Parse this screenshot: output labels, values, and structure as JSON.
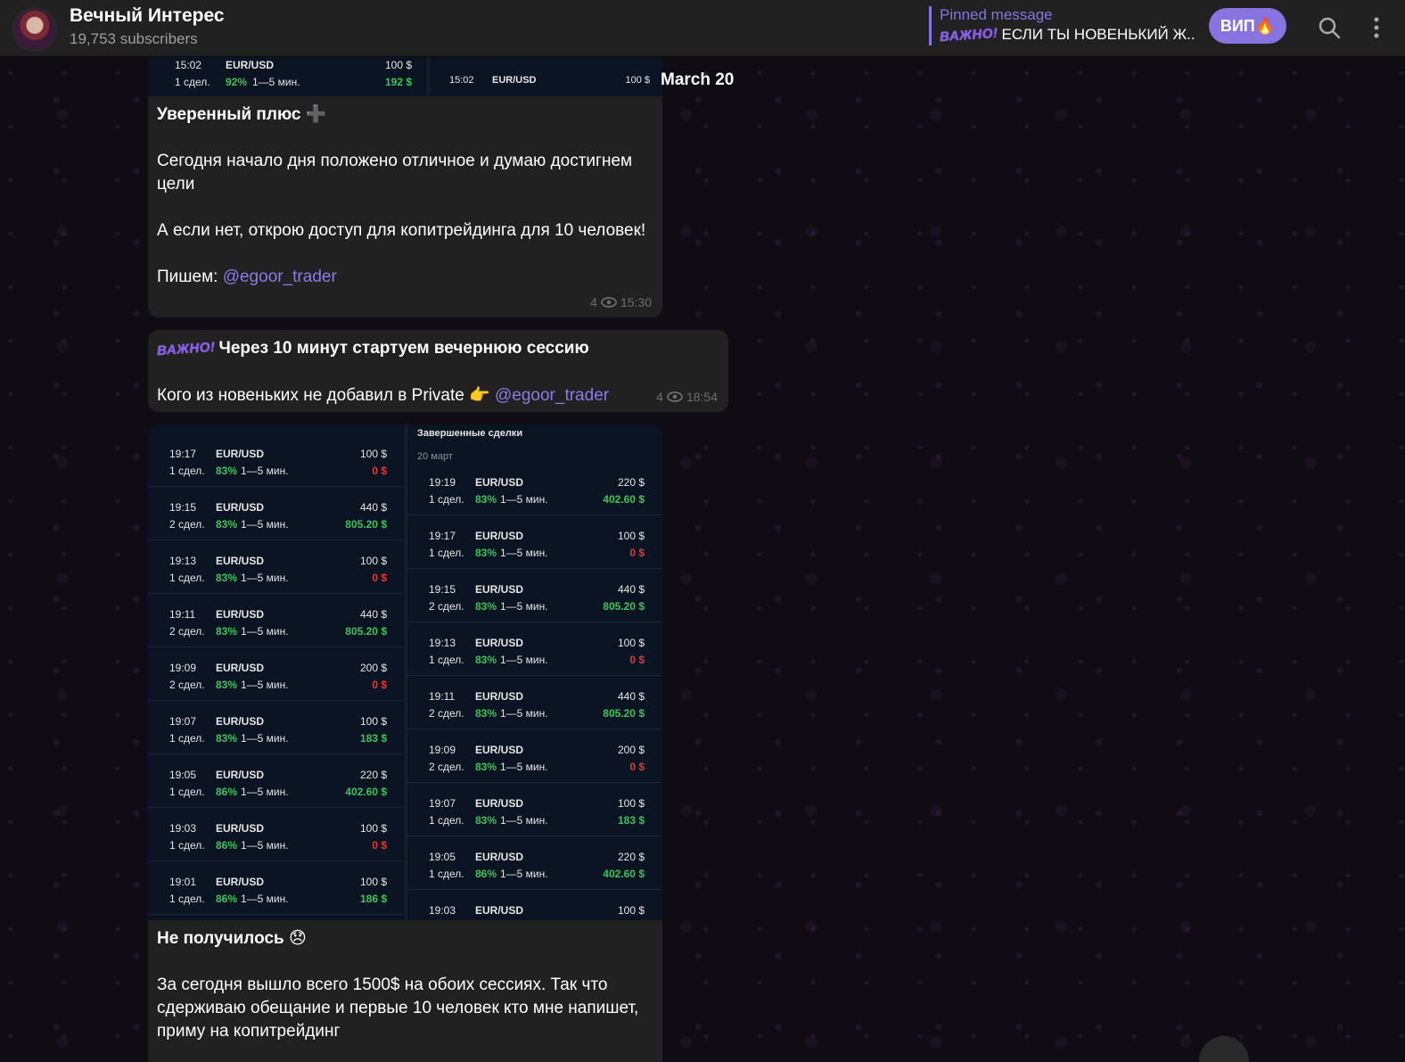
{
  "channel": {
    "title": "Вечный Интерес",
    "subscribers": "19,753 subscribers"
  },
  "pinned": {
    "title": "Pinned message",
    "tag": "ВАЖНО!",
    "text": "ЕСЛИ ТЫ НОВЕНЬКИЙ Ж..."
  },
  "vip_button": "ВИП🔥",
  "date_separator": "March 20",
  "top_image": {
    "left": {
      "time": "15:02",
      "pair": "EUR/USD",
      "amount": "100 $",
      "count": "1 сдел.",
      "pct": "92%",
      "dur": "1—5 мин.",
      "result": "192 $"
    },
    "right": {
      "time": "15:02",
      "pair": "EUR/USD",
      "amount": "100 $"
    }
  },
  "msg1": {
    "title": "Уверенный плюс ➕",
    "p1": "Сегодня начало дня положено отличное и думаю достигнем цели",
    "p2": "А если нет, открою доступ для копитрейдинга для 10 человек!",
    "p3_prefix": "Пишем: ",
    "p3_link": "@egoor_trader",
    "views": "4",
    "time": "15:30"
  },
  "msg2": {
    "tag": "ВАЖНО!",
    "title": "Через 10 минут стартуем вечернюю сессию",
    "p1_prefix": "Кого из новеньких не добавил в Private 👉 ",
    "p1_link": "@egoor_trader",
    "views": "4",
    "time": "18:54"
  },
  "shot": {
    "right_heading": "Завершенные сделки",
    "right_date": "20 март",
    "left_rows": [
      {
        "time": "19:17",
        "pair": "EUR/USD",
        "amount": "100 $",
        "count": "1 сдел.",
        "pct": "83%",
        "dur": "1—5 мин.",
        "result": "0 $",
        "win": false
      },
      {
        "time": "19:15",
        "pair": "EUR/USD",
        "amount": "440 $",
        "count": "2 сдел.",
        "pct": "83%",
        "dur": "1—5 мин.",
        "result": "805.20 $",
        "win": true
      },
      {
        "time": "19:13",
        "pair": "EUR/USD",
        "amount": "100 $",
        "count": "1 сдел.",
        "pct": "83%",
        "dur": "1—5 мин.",
        "result": "0 $",
        "win": false
      },
      {
        "time": "19:11",
        "pair": "EUR/USD",
        "amount": "440 $",
        "count": "2 сдел.",
        "pct": "83%",
        "dur": "1—5 мин.",
        "result": "805.20 $",
        "win": true
      },
      {
        "time": "19:09",
        "pair": "EUR/USD",
        "amount": "200 $",
        "count": "2 сдел.",
        "pct": "83%",
        "dur": "1—5 мин.",
        "result": "0 $",
        "win": false
      },
      {
        "time": "19:07",
        "pair": "EUR/USD",
        "amount": "100 $",
        "count": "1 сдел.",
        "pct": "83%",
        "dur": "1—5 мин.",
        "result": "183 $",
        "win": true
      },
      {
        "time": "19:05",
        "pair": "EUR/USD",
        "amount": "220 $",
        "count": "1 сдел.",
        "pct": "86%",
        "dur": "1—5 мин.",
        "result": "402.60 $",
        "win": true
      },
      {
        "time": "19:03",
        "pair": "EUR/USD",
        "amount": "100 $",
        "count": "1 сдел.",
        "pct": "86%",
        "dur": "1—5 мин.",
        "result": "0 $",
        "win": false
      },
      {
        "time": "19:01",
        "pair": "EUR/USD",
        "amount": "100 $",
        "count": "1 сдел.",
        "pct": "86%",
        "dur": "1—5 мин.",
        "result": "186 $",
        "win": true
      }
    ],
    "right_rows": [
      {
        "time": "19:19",
        "pair": "EUR/USD",
        "amount": "220 $",
        "count": "1 сдел.",
        "pct": "83%",
        "dur": "1—5 мин.",
        "result": "402.60 $",
        "win": true
      },
      {
        "time": "19:17",
        "pair": "EUR/USD",
        "amount": "100 $",
        "count": "1 сдел.",
        "pct": "83%",
        "dur": "1—5 мин.",
        "result": "0 $",
        "win": false
      },
      {
        "time": "19:15",
        "pair": "EUR/USD",
        "amount": "440 $",
        "count": "2 сдел.",
        "pct": "83%",
        "dur": "1—5 мин.",
        "result": "805.20 $",
        "win": true
      },
      {
        "time": "19:13",
        "pair": "EUR/USD",
        "amount": "100 $",
        "count": "1 сдел.",
        "pct": "83%",
        "dur": "1—5 мин.",
        "result": "0 $",
        "win": false
      },
      {
        "time": "19:11",
        "pair": "EUR/USD",
        "amount": "440 $",
        "count": "2 сдел.",
        "pct": "83%",
        "dur": "1—5 мин.",
        "result": "805.20 $",
        "win": true
      },
      {
        "time": "19:09",
        "pair": "EUR/USD",
        "amount": "200 $",
        "count": "2 сдел.",
        "pct": "83%",
        "dur": "1—5 мин.",
        "result": "0 $",
        "win": false
      },
      {
        "time": "19:07",
        "pair": "EUR/USD",
        "amount": "100 $",
        "count": "1 сдел.",
        "pct": "83%",
        "dur": "1—5 мин.",
        "result": "183 $",
        "win": true
      },
      {
        "time": "19:05",
        "pair": "EUR/USD",
        "amount": "220 $",
        "count": "1 сдел.",
        "pct": "86%",
        "dur": "1—5 мин.",
        "result": "402.60 $",
        "win": true
      },
      {
        "time": "19:03",
        "pair": "EUR/USD",
        "amount": "100 $",
        "count": "",
        "pct": "",
        "dur": "",
        "result": "",
        "win": true
      }
    ]
  },
  "msg3": {
    "title": "Не получилось 😞",
    "p1": "За сегодня вышло всего 1500$ на обоих сессиях.  Так что сдерживаю обещание и первые 10 человек кто мне напишет, приму на копитрейдинг"
  }
}
